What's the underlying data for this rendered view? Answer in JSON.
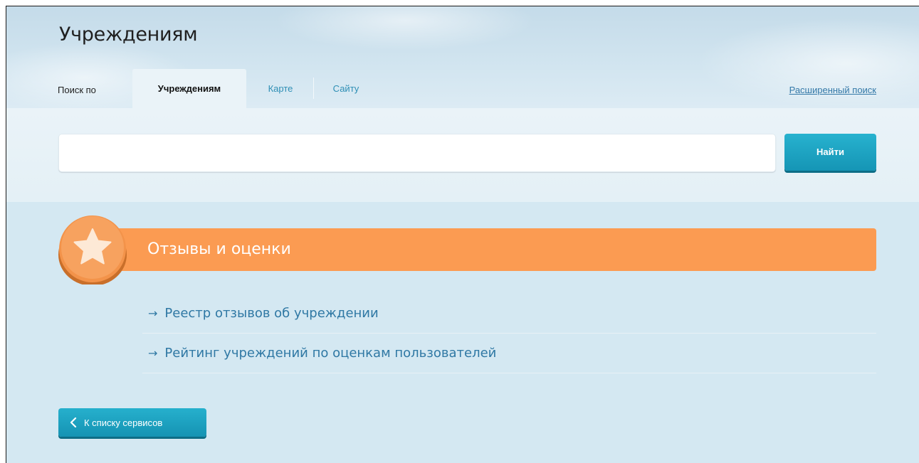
{
  "header": {
    "title": "Учреждениям",
    "tabs_prefix": "Поиск по",
    "tabs": [
      {
        "label": "Учреждениям",
        "active": true
      },
      {
        "label": "Карте",
        "active": false
      },
      {
        "label": "Сайту",
        "active": false
      }
    ],
    "advanced_search": "Расширенный поиск"
  },
  "search": {
    "value": "",
    "button_label": "Найти"
  },
  "section": {
    "title": "Отзывы и оценки",
    "icon": "star-icon",
    "links": [
      "Реестр отзывов об учреждении",
      "Рейтинг учреждений по оценкам пользователей"
    ]
  },
  "footer": {
    "back_label": "К списку сервисов"
  },
  "colors": {
    "accent": "#1ba3c3",
    "orange": "#fb9b52",
    "link": "#2f78a4"
  }
}
